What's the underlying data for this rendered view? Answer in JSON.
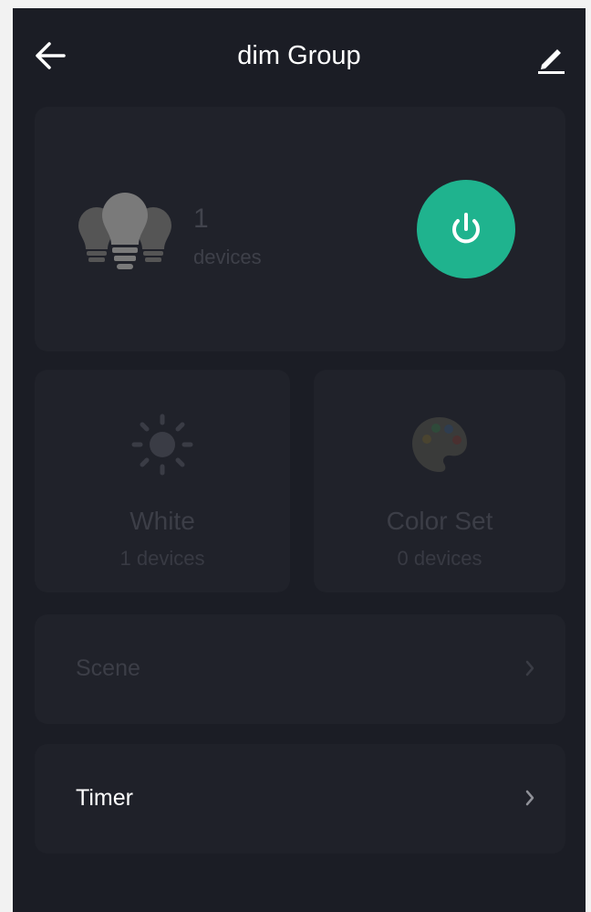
{
  "header": {
    "title": "dim Group"
  },
  "group": {
    "count": "1",
    "count_label": "devices"
  },
  "tiles": [
    {
      "label": "White",
      "sub": "1 devices"
    },
    {
      "label": "Color Set",
      "sub": "0 devices"
    }
  ],
  "rows": [
    {
      "label": "Scene"
    },
    {
      "label": "Timer"
    }
  ],
  "icons": {
    "back": "arrow-left-icon",
    "edit": "pencil-icon",
    "bulbs": "light-bulbs-icon",
    "power": "power-icon",
    "white": "sun-icon",
    "color": "palette-icon",
    "chevron": "chevron-right-icon"
  },
  "colors": {
    "background": "#1b1d25",
    "card": "#20222a",
    "accent": "#1fb38e",
    "text": "#ffffff",
    "muted_text": "#3c3e47"
  }
}
